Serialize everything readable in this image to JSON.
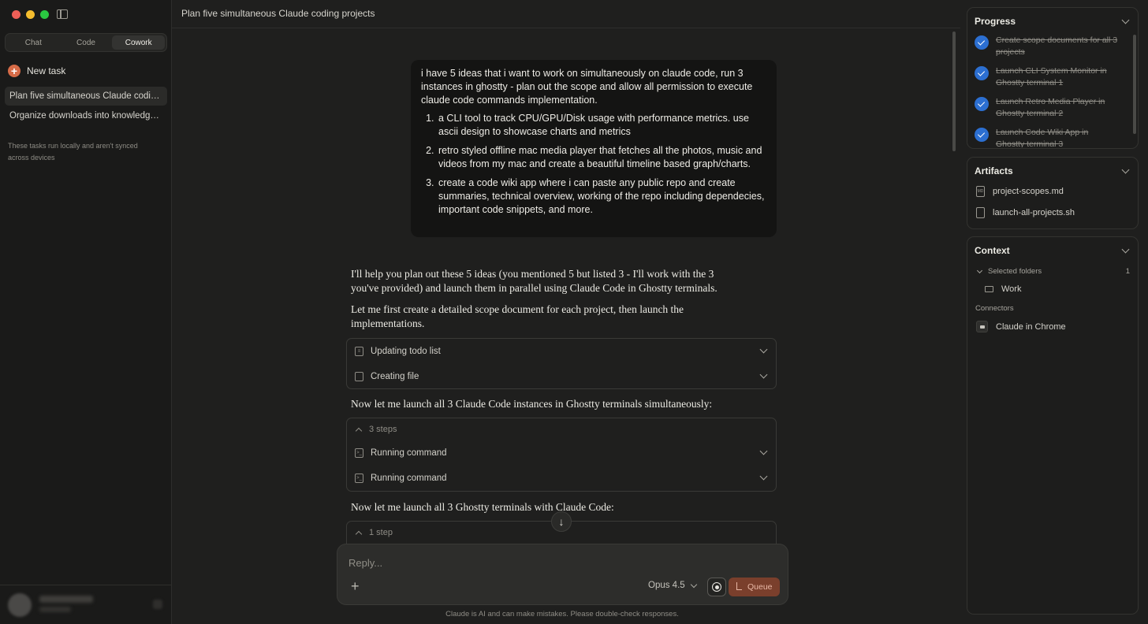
{
  "sidebar": {
    "tabs": [
      "Chat",
      "Code",
      "Cowork"
    ],
    "active_tab": "Cowork",
    "new_task_label": "New task",
    "tasks": [
      {
        "label": "Plan five simultaneous Claude coding projects",
        "active": true
      },
      {
        "label": "Organize downloads into knowledge base",
        "active": false
      }
    ],
    "note": "These tasks run locally and aren't synced across devices"
  },
  "header": {
    "title": "Plan five simultaneous Claude coding projects"
  },
  "conversation": {
    "user_message": {
      "intro": "i have 5 ideas that i want to work on simultaneously on claude code, run 3 instances in ghostty - plan out the scope and allow all permission to execute claude code commands implementation.",
      "items": [
        "a CLI tool to track CPU/GPU/Disk usage with performance metrics. use ascii design to showcase charts and metrics",
        "retro styled offline mac media player that fetches all the photos, music and videos from my mac and create a beautiful timeline based graph/charts.",
        "create a code wiki app where i can paste any public repo and create summaries, technical overview, working of the repo including dependecies, important code snippets, and more."
      ]
    },
    "assistant_paragraph_1": "I'll help you plan out these 5 ideas (you mentioned 5 but listed 3 - I'll work with the 3 you've provided) and launch them in parallel using Claude Code in Ghostty terminals.",
    "assistant_paragraph_2": "Let me first create a detailed scope document for each project, then launch the implementations.",
    "tool_group_1": [
      "Updating todo list",
      "Creating file"
    ],
    "assistant_paragraph_3": "Now let me launch all 3 Claude Code instances in Ghostty terminals simultaneously:",
    "tool_group_2": {
      "steps_label": "3 steps",
      "rows": [
        "Running command",
        "Running command"
      ]
    },
    "assistant_paragraph_4": "Now let me launch all 3 Ghostty terminals with Claude Code:",
    "tool_group_3": {
      "steps_label": "1 step"
    }
  },
  "composer": {
    "placeholder": "Reply...",
    "model": "Opus 4.5",
    "queue_label": "Queue",
    "disclaimer": "Claude is AI and can make mistakes. Please double-check responses."
  },
  "right_panel": {
    "progress": {
      "title": "Progress",
      "items": [
        "Create scope documents for all 3 projects",
        "Launch CLI System Monitor in Ghostty terminal 1",
        "Launch Retro Media Player in Ghostty terminal 2",
        "Launch Code Wiki App in Ghostty terminal 3"
      ]
    },
    "artifacts": {
      "title": "Artifacts",
      "items": [
        "project-scopes.md",
        "launch-all-projects.sh"
      ],
      "icon_labels": [
        "MD",
        ""
      ]
    },
    "context": {
      "title": "Context",
      "selected_folders_label": "Selected folders",
      "selected_folders_count": "1",
      "folders": [
        "Work"
      ],
      "connectors_label": "Connectors",
      "connectors": [
        "Claude in Chrome"
      ]
    }
  },
  "colors": {
    "accent": "#d66b47",
    "check": "#2c6fd1",
    "queue_button": "#7a3f2c",
    "background": "#1f1f1e"
  }
}
